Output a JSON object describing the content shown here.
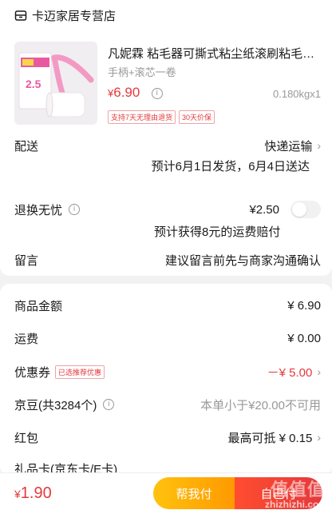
{
  "store": {
    "name": "卡迈家居专营店"
  },
  "product": {
    "title": "凡妮霖 粘毛器可撕式粘尘纸滚刷粘毛…",
    "spec": "手柄+滚芯一卷",
    "price_currency": "¥",
    "price_value": "6.90",
    "weight_qty": "0.180kgx1",
    "tags": [
      "支持7天无理由退货",
      "30天价保"
    ],
    "thumb_text": "2.5"
  },
  "delivery": {
    "label": "配送",
    "method": "快递运输",
    "eta": "预计6月1日发货，6月4日送达"
  },
  "return_insurance": {
    "label": "退换无忧",
    "price": "¥2.50",
    "note": "预计获得8元的运费赔付"
  },
  "message": {
    "label": "留言",
    "placeholder": "建议留言前先与商家沟通确认"
  },
  "summary": {
    "goods_amount_label": "商品金额",
    "goods_amount": "¥ 6.90",
    "shipping_label": "运费",
    "shipping": "¥ 0.00",
    "coupon_label": "优惠券",
    "coupon_tag": "已选推荐优惠",
    "coupon": "－¥ 5.00",
    "jd_beans_label": "京豆(共3284个)",
    "jd_beans_note": "本单小于¥20.00不可用",
    "red_packet_label": "红包",
    "red_packet": "最高可抵 ¥ 0.15",
    "gift_card_label": "礼品卡(京东卡/E卡)"
  },
  "bottom": {
    "total_currency": "¥",
    "total_value": "1.90",
    "help_pay": "帮我付",
    "self_pay": "自己付"
  },
  "watermark": {
    "main": "值值值",
    "sub": "zhizhizhi.com"
  },
  "colors": {
    "accent": "#e4393c",
    "help_btn": "#ffb400"
  }
}
